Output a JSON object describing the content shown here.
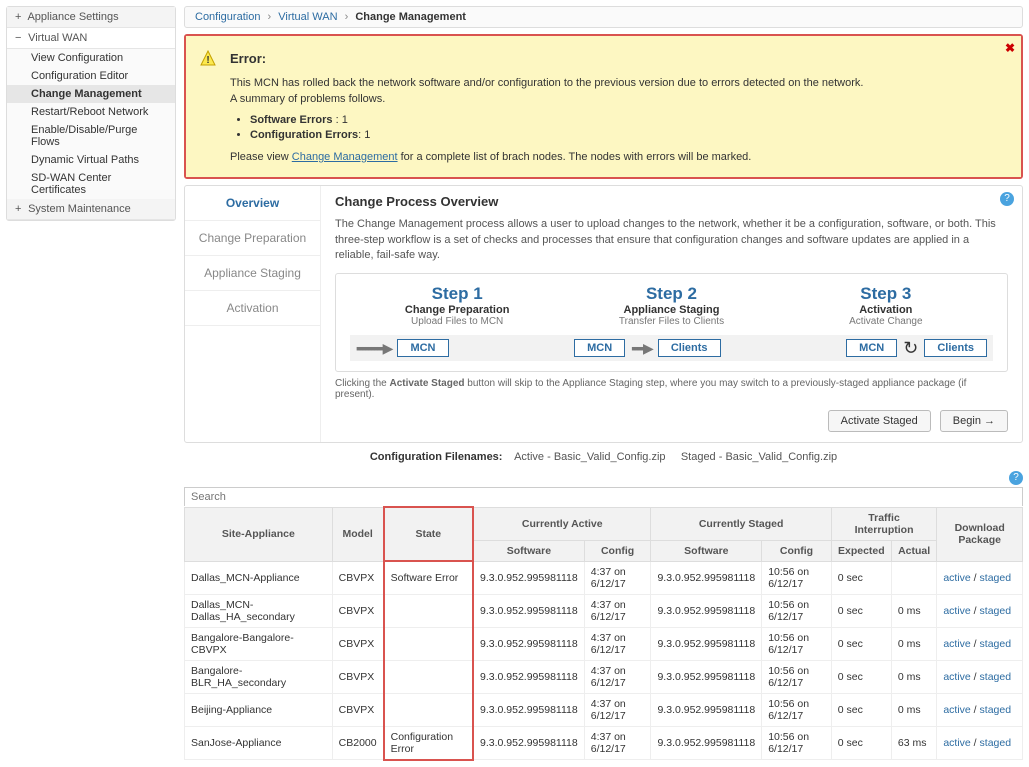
{
  "sidebar": {
    "sections": [
      {
        "label": "Appliance Settings",
        "symbol": "+",
        "expanded": false
      },
      {
        "label": "Virtual WAN",
        "symbol": "−",
        "expanded": true,
        "items": [
          "View Configuration",
          "Configuration Editor",
          "Change Management",
          "Restart/Reboot Network",
          "Enable/Disable/Purge Flows",
          "Dynamic Virtual Paths",
          "SD-WAN Center Certificates"
        ],
        "active_index": 2
      },
      {
        "label": "System Maintenance",
        "symbol": "+",
        "expanded": false
      }
    ]
  },
  "breadcrumb": {
    "a": "Configuration",
    "b": "Virtual WAN",
    "c": "Change Management"
  },
  "alert": {
    "title": "Error:",
    "body1": "This MCN has rolled back the network software and/or configuration to the previous version due to errors detected on the network.",
    "body2": "A summary of problems follows.",
    "bullets": [
      {
        "label": "Software Errors",
        "count": "1"
      },
      {
        "label": "Configuration Errors",
        "count": "1"
      }
    ],
    "tail_pre": "Please view ",
    "tail_link": "Change Management",
    "tail_post": " for a complete list of brach nodes. The nodes with errors will be marked."
  },
  "tabs": [
    "Overview",
    "Change Preparation",
    "Appliance Staging",
    "Activation"
  ],
  "overview": {
    "heading": "Change Process Overview",
    "para": "The Change Management process allows a user to upload changes to the network, whether it be a configuration, software, or both. This three-step workflow is a set of checks and processes that ensure that configuration changes and software updates are applied in a reliable, fail-safe way.",
    "steps": [
      {
        "title": "Step 1",
        "sub": "Change Preparation",
        "desc": "Upload Files to MCN"
      },
      {
        "title": "Step 2",
        "sub": "Appliance Staging",
        "desc": "Transfer Files to Clients"
      },
      {
        "title": "Step 3",
        "sub": "Activation",
        "desc": "Activate Change"
      }
    ],
    "flow_btns": {
      "mcn": "MCN",
      "clients": "Clients"
    },
    "note_pre": "Clicking the ",
    "note_bold": "Activate Staged",
    "note_post": " button will skip to the Appliance Staging step, where you may switch to a previously-staged appliance package (if present).",
    "btn_activate": "Activate Staged",
    "btn_begin": "Begin →"
  },
  "config_names": {
    "label": "Configuration Filenames:",
    "active_lbl": "Active - ",
    "active_val": "Basic_Valid_Config.zip",
    "staged_lbl": "Staged - ",
    "staged_val": "Basic_Valid_Config.zip"
  },
  "table": {
    "search_placeholder": "Search",
    "headers": {
      "site": "Site-Appliance",
      "model": "Model",
      "state": "State",
      "cur_active": "Currently Active",
      "cur_staged": "Currently Staged",
      "traffic": "Traffic Interruption",
      "download": "Download Package",
      "software": "Software",
      "config": "Config",
      "expected": "Expected",
      "actual": "Actual"
    },
    "rows": [
      {
        "site": "Dallas_MCN-Appliance",
        "model": "CBVPX",
        "state": "Software Error",
        "asw": "9.3.0.952.995981118",
        "acfg": "4:37 on 6/12/17",
        "ssw": "9.3.0.952.995981118",
        "scfg": "10:56 on 6/12/17",
        "exp": "0 sec",
        "act": "",
        "dl": "active / staged"
      },
      {
        "site": "Dallas_MCN-Dallas_HA_secondary",
        "model": "CBVPX",
        "state": "",
        "asw": "9.3.0.952.995981118",
        "acfg": "4:37 on 6/12/17",
        "ssw": "9.3.0.952.995981118",
        "scfg": "10:56 on 6/12/17",
        "exp": "0 sec",
        "act": "0 ms",
        "dl": "active / staged"
      },
      {
        "site": "Bangalore-Bangalore-CBVPX",
        "model": "CBVPX",
        "state": "",
        "asw": "9.3.0.952.995981118",
        "acfg": "4:37 on 6/12/17",
        "ssw": "9.3.0.952.995981118",
        "scfg": "10:56 on 6/12/17",
        "exp": "0 sec",
        "act": "0 ms",
        "dl": "active / staged"
      },
      {
        "site": "Bangalore-BLR_HA_secondary",
        "model": "CBVPX",
        "state": "",
        "asw": "9.3.0.952.995981118",
        "acfg": "4:37 on 6/12/17",
        "ssw": "9.3.0.952.995981118",
        "scfg": "10:56 on 6/12/17",
        "exp": "0 sec",
        "act": "0 ms",
        "dl": "active / staged"
      },
      {
        "site": "Beijing-Appliance",
        "model": "CBVPX",
        "state": "",
        "asw": "9.3.0.952.995981118",
        "acfg": "4:37 on 6/12/17",
        "ssw": "9.3.0.952.995981118",
        "scfg": "10:56 on 6/12/17",
        "exp": "0 sec",
        "act": "0 ms",
        "dl": "active / staged"
      },
      {
        "site": "SanJose-Appliance",
        "model": "CB2000",
        "state": "Configuration Error",
        "asw": "9.3.0.952.995981118",
        "acfg": "4:37 on 6/12/17",
        "ssw": "9.3.0.952.995981118",
        "scfg": "10:56 on 6/12/17",
        "exp": "0 sec",
        "act": "63 ms",
        "dl": "active / staged"
      }
    ]
  }
}
